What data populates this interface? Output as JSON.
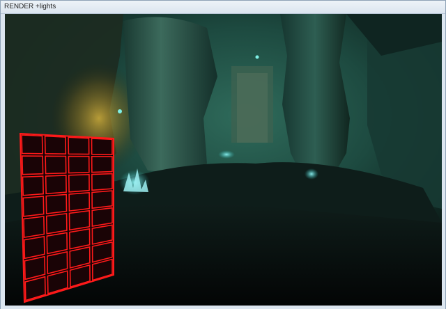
{
  "window": {
    "title": "RENDER +lights"
  },
  "scene": {
    "description_icons": [
      "cave-scene",
      "rock-pillar",
      "crystal-cluster",
      "wall-grid"
    ],
    "grid": {
      "columns": 4,
      "rows": 8,
      "color": "#ff1a1a"
    },
    "colors": {
      "fog": "#1f5a4c",
      "glow_warm": "#b79a2a",
      "crystal": "#6ee8ee",
      "floor": "#050707"
    }
  }
}
